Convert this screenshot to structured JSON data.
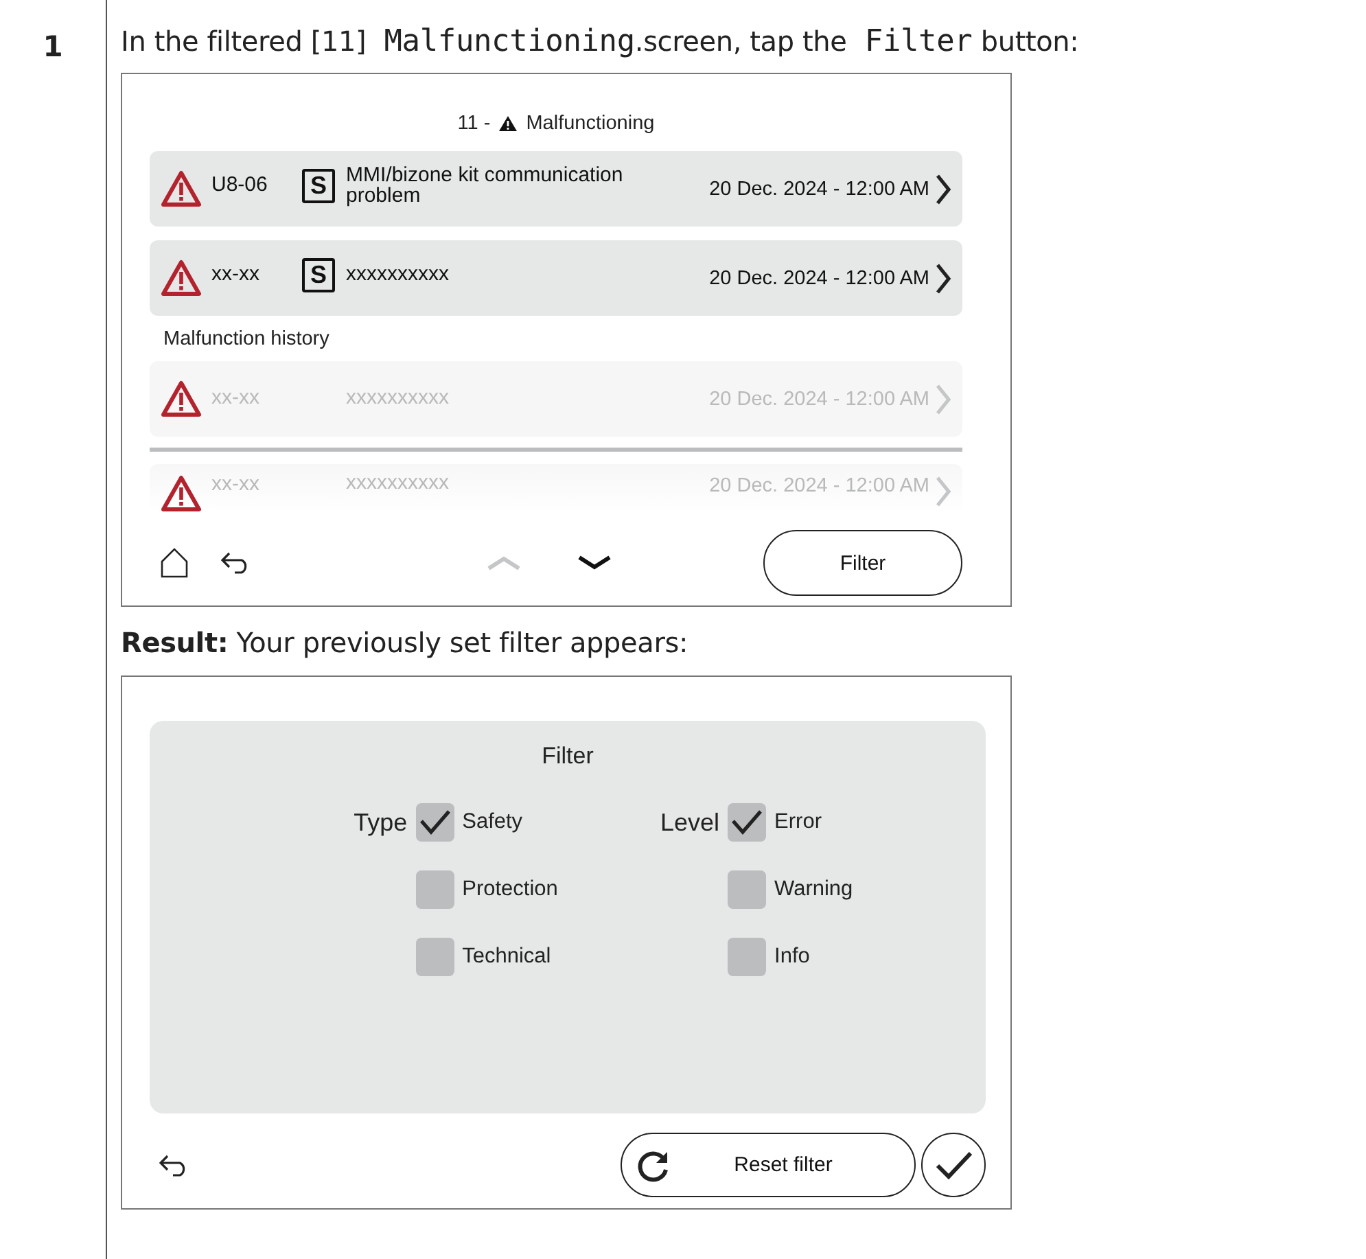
{
  "step": {
    "number": "1",
    "instruction": [
      {
        "kind": "plain",
        "text": "In the filtered [11] "
      },
      {
        "kind": "code",
        "text": "Malfunctioning"
      },
      {
        "kind": "plain",
        "text": ".screen, tap the "
      },
      {
        "kind": "code",
        "text": "Filter"
      },
      {
        "kind": "plain",
        "text": " button:"
      }
    ],
    "malfunction_screen": {
      "title_number": "11 -",
      "title": "Malfunctioning",
      "rows": [
        {
          "kind": "active",
          "code": "U8-06",
          "badge": "S",
          "description": "MMI/bizone kit communication problem",
          "date": "20 Dec. 2024 - 12:00 AM"
        },
        {
          "kind": "active",
          "code": "xx-xx",
          "badge": "S",
          "description": "xxxxxxxxxx",
          "date": "20 Dec. 2024 - 12:00 AM"
        }
      ],
      "history_label": "Malfunction history",
      "history_rows": [
        {
          "kind": "history",
          "code": "xx-xx",
          "description": "xxxxxxxxxx",
          "date": "20 Dec. 2024 - 12:00 AM"
        },
        {
          "kind": "cut",
          "code": "xx-xx",
          "description": "xxxxxxxxxx",
          "date": "20 Dec. 2024 - 12:00 AM"
        }
      ],
      "scroll_up_disabled": true,
      "filter_button": "Filter"
    },
    "result": "**Result:** Your previously set filter appears:",
    "filter_screen": {
      "title": "Filter",
      "groups": [
        {
          "label": "Type",
          "options": [
            {
              "label": "Safety",
              "checked": true
            },
            {
              "label": "Protection",
              "checked": false
            },
            {
              "label": "Technical",
              "checked": false
            }
          ]
        },
        {
          "label": "Level",
          "options": [
            {
              "label": "Error",
              "checked": true
            },
            {
              "label": "Warning",
              "checked": false
            },
            {
              "label": "Info",
              "checked": false
            }
          ]
        }
      ],
      "reset_button": "Reset filter"
    }
  }
}
